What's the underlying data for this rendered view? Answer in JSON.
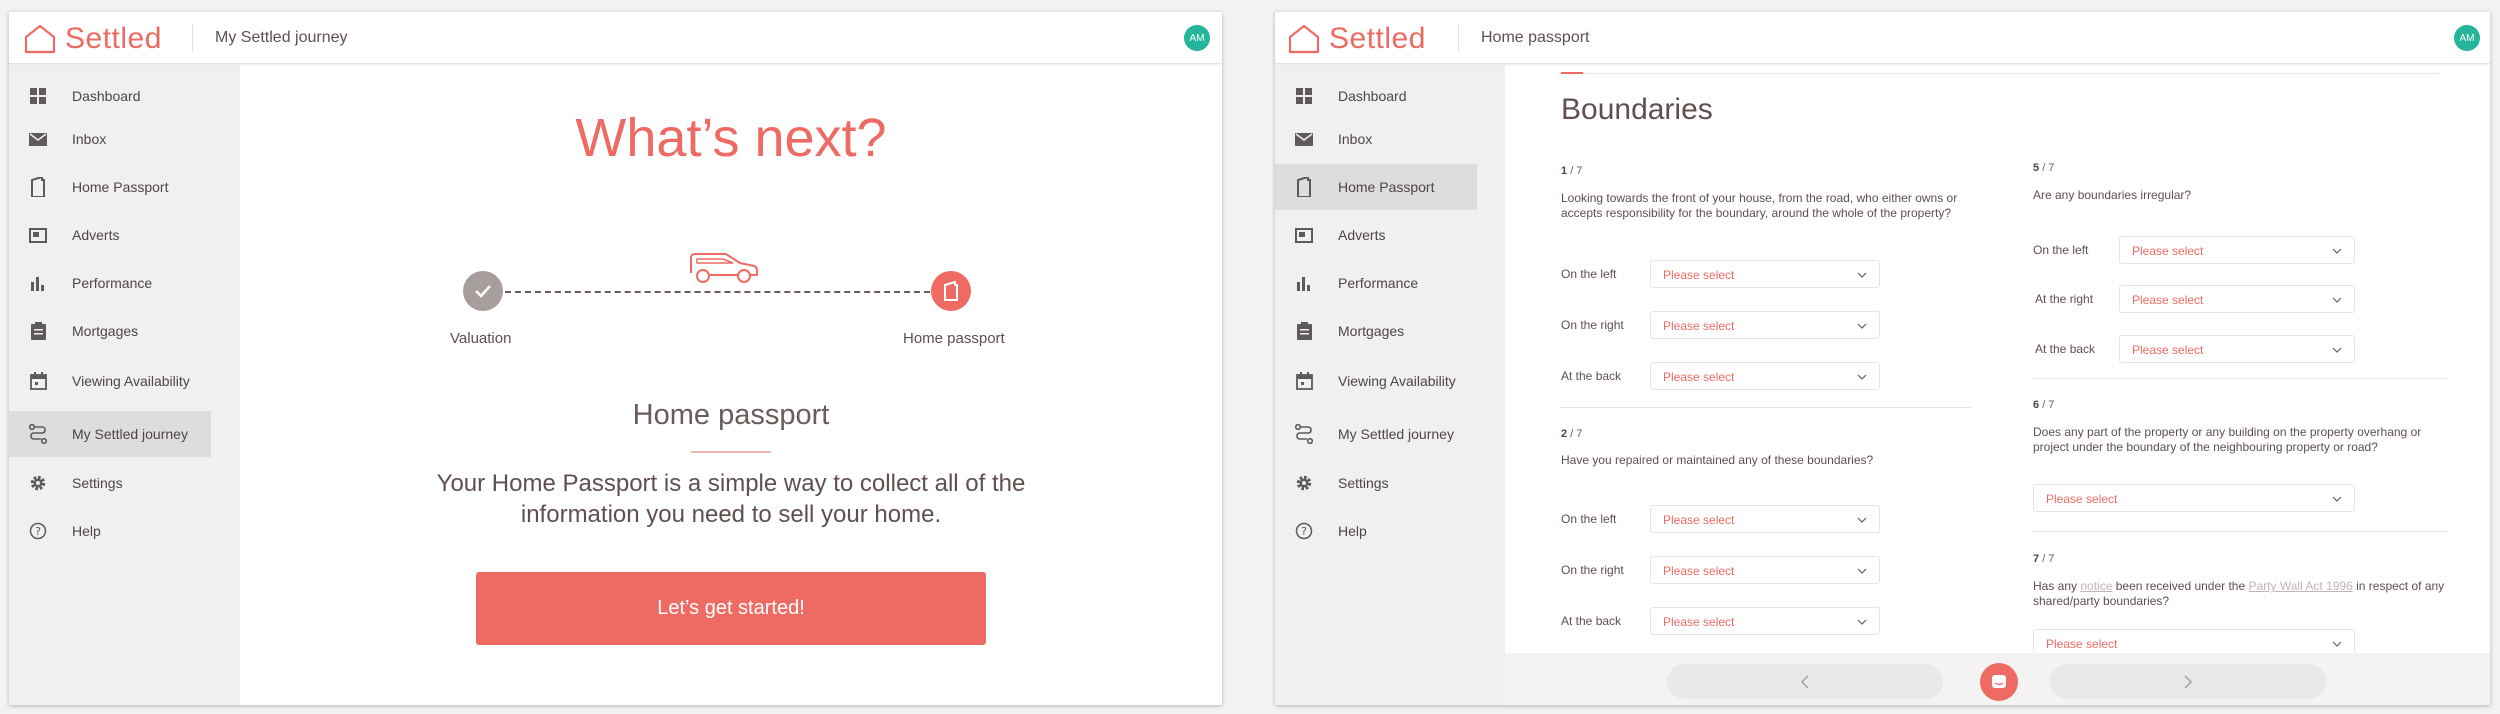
{
  "brand": {
    "name": "Settled",
    "accent": "#ee6b63",
    "avatar_color": "#25b59a"
  },
  "sidebar": {
    "items": [
      {
        "label": "Dashboard",
        "icon": "grid-icon"
      },
      {
        "label": "Inbox",
        "icon": "mail-icon"
      },
      {
        "label": "Home Passport",
        "icon": "passport-icon"
      },
      {
        "label": "Adverts",
        "icon": "advert-icon"
      },
      {
        "label": "Performance",
        "icon": "bar-chart-icon"
      },
      {
        "label": "Mortgages",
        "icon": "clipboard-icon"
      },
      {
        "label": "Viewing Availability",
        "icon": "calendar-icon"
      },
      {
        "label": "My Settled journey",
        "icon": "route-icon"
      },
      {
        "label": "Settings",
        "icon": "gear-icon"
      },
      {
        "label": "Help",
        "icon": "help-icon"
      }
    ]
  },
  "window1": {
    "header_title": "My Settled journey",
    "avatar": "AM",
    "active_item": "My Settled journey",
    "hero_title": "What’s next?",
    "steps": [
      {
        "label": "Valuation",
        "state": "done"
      },
      {
        "label": "Home passport",
        "state": "current"
      }
    ],
    "section_title": "Home passport",
    "section_desc": "Your Home Passport is a simple way to collect all of the information you need to sell your home.",
    "cta_label": "Let’s get started!"
  },
  "window2": {
    "header_title": "Home passport",
    "avatar": "AM",
    "active_item": "Home Passport",
    "form_title": "Boundaries",
    "select_placeholder": "Please select",
    "questions": [
      {
        "num": "1",
        "total": "/ 7",
        "text": "Looking towards the front of your house, from the road, who either owns or accepts responsibility for the boundary, around the whole of the property?",
        "rows": [
          "On the left",
          "On the right",
          "At the back"
        ]
      },
      {
        "num": "2",
        "total": "/ 7",
        "text": "Have you repaired or maintained any of these boundaries?",
        "rows": [
          "On the left",
          "On the right",
          "At the back"
        ]
      },
      {
        "num": "5",
        "total": "/ 7",
        "text": "Are any boundaries irregular?",
        "rows": [
          "On the left",
          "At the right",
          "At the back"
        ]
      },
      {
        "num": "6",
        "total": "/ 7",
        "text": "Does any part of the property or any building on the property overhang or project under the boundary of the neighbouring property or road?"
      },
      {
        "num": "7",
        "total": "/ 7",
        "text_before": "Has any ",
        "link1": "notice",
        "text_middle": " been received under the ",
        "link2": "Party Wall Act 1996",
        "text_after": " in respect of any shared/party boundaries?"
      }
    ]
  }
}
